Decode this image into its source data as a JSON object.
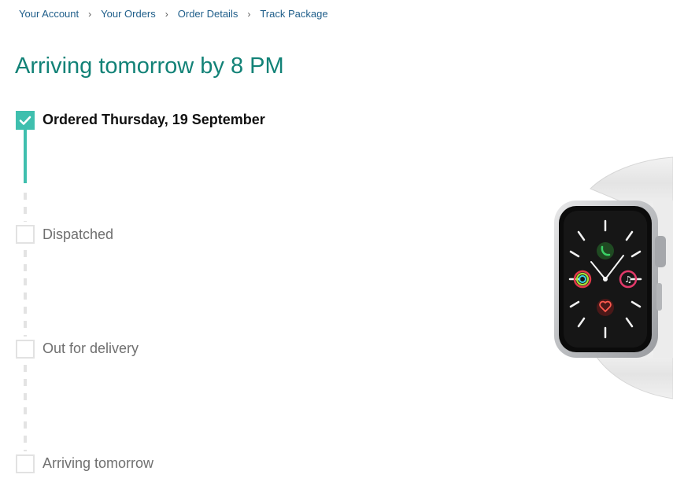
{
  "breadcrumb": {
    "items": [
      "Your Account",
      "Your Orders",
      "Order Details",
      "Track Package"
    ],
    "separator": "›"
  },
  "headline": "Arriving tomorrow by 8 PM",
  "timeline": {
    "steps": [
      {
        "label": "Ordered Thursday, 19 September",
        "completed": true
      },
      {
        "label": "Dispatched",
        "completed": false
      },
      {
        "label": "Out for delivery",
        "completed": false
      },
      {
        "label": "Arriving tomorrow",
        "completed": false
      }
    ]
  },
  "product": {
    "image": "smartwatch-image"
  },
  "colors": {
    "accent": "#128277",
    "progress": "#3fbfae",
    "link": "#1f5e8a",
    "pending_border": "#e2e2e2"
  }
}
